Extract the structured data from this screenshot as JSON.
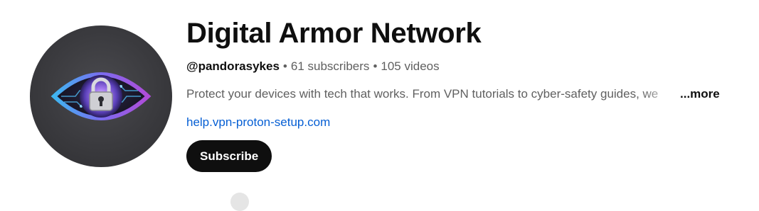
{
  "channel": {
    "name": "Digital Armor Network",
    "handle": "@pandorasykes",
    "separator": "•",
    "subscribers": "61 subscribers",
    "videos": "105 videos",
    "description": "Protect your devices with tech that works. From VPN tutorials to cyber-safety guides, we",
    "more_label": "...more",
    "link": "help.vpn-proton-setup.com",
    "subscribe_label": "Subscribe",
    "avatar_icon": "eye-lock-icon"
  },
  "colors": {
    "title": "#0f0f0f",
    "meta": "#606060",
    "link": "#065fd4",
    "subscribe_bg": "#0f0f0f",
    "subscribe_text": "#ffffff",
    "avatar_bg": "#3a3a3e",
    "eye_iris": "#7b5cd6",
    "eye_outline": "#3fa9f5"
  }
}
